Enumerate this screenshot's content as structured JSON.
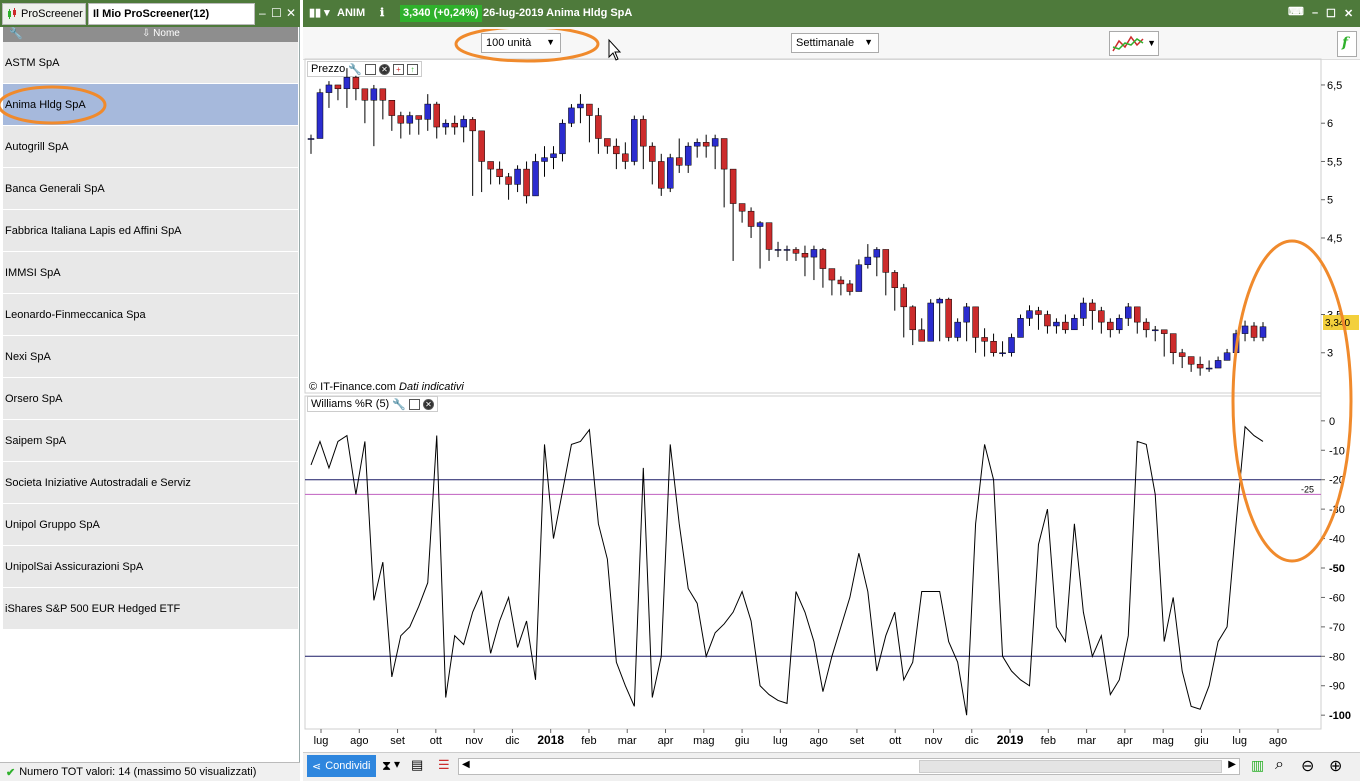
{
  "left_panel": {
    "tab1_label": "ProScreener",
    "tab2_label": "Il Mio ProScreener(12)",
    "column_header": "Nome",
    "items": [
      {
        "label": "ASTM SpA"
      },
      {
        "label": "Anima Hldg SpA"
      },
      {
        "label": "Autogrill SpA"
      },
      {
        "label": "Banca Generali SpA"
      },
      {
        "label": "Fabbrica Italiana Lapis ed Affini SpA"
      },
      {
        "label": "IMMSI SpA"
      },
      {
        "label": "Leonardo-Finmeccanica Spa"
      },
      {
        "label": "Nexi SpA"
      },
      {
        "label": "Orsero SpA"
      },
      {
        "label": "Saipem SpA"
      },
      {
        "label": "Societa Iniziative Autostradali e Serviz"
      },
      {
        "label": "Unipol Gruppo SpA"
      },
      {
        "label": "UnipolSai Assicurazioni SpA"
      },
      {
        "label": "iShares S&P 500 EUR Hedged ETF"
      }
    ],
    "selected_index": 1,
    "status_text": "Numero TOT valori: 14 (massimo 50 visualizzati)"
  },
  "right_panel": {
    "ticker": "ANIM",
    "price_badge": "3,340 (+0,24%)",
    "title": "26-lug-2019 Anima Hldg SpA",
    "units_select": "100 unità",
    "period_select": "Settimanale",
    "price_panel_title": "Prezzo",
    "indicator_panel_title": "Williams %R (5)",
    "watermark": "© IT-Finance.com",
    "watermark_note": "Dati indicativi",
    "last_price_label": "3,340",
    "share_button": "Condividi",
    "colors": {
      "header": "#4e7a3b",
      "up": "#2b2ccf",
      "down": "#cc2b2b",
      "badge": "#2fb12c",
      "annotation": "#f08a2c"
    }
  },
  "chart_data": [
    {
      "type": "candlestick",
      "title": "Prezzo",
      "ylim": [
        2.5,
        6.8
      ],
      "y_ticks": [
        "6,5",
        "6",
        "5,5",
        "5",
        "4,5",
        "3,5",
        "3"
      ],
      "x_ticks": [
        "lug",
        "ago",
        "set",
        "ott",
        "nov",
        "dic",
        "2018",
        "feb",
        "mar",
        "apr",
        "mag",
        "giu",
        "lug",
        "ago",
        "set",
        "ott",
        "nov",
        "dic",
        "2019",
        "feb",
        "mar",
        "apr",
        "mag",
        "giu",
        "lug",
        "ago"
      ],
      "close": [
        5.8,
        6.4,
        6.5,
        6.45,
        6.6,
        6.45,
        6.3,
        6.45,
        6.3,
        6.1,
        6.0,
        6.1,
        6.05,
        6.25,
        5.95,
        6.0,
        5.95,
        6.05,
        5.9,
        5.5,
        5.4,
        5.3,
        5.2,
        5.4,
        5.05,
        5.5,
        5.55,
        5.6,
        6.0,
        6.2,
        6.25,
        6.1,
        5.8,
        5.7,
        5.6,
        5.5,
        6.05,
        5.7,
        5.5,
        5.15,
        5.55,
        5.45,
        5.7,
        5.75,
        5.7,
        5.8,
        5.4,
        4.95,
        4.85,
        4.65,
        4.7,
        4.35,
        4.35,
        4.35,
        4.3,
        4.25,
        4.35,
        4.1,
        3.95,
        3.9,
        3.8,
        4.15,
        4.25,
        4.35,
        4.05,
        3.85,
        3.6,
        3.3,
        3.15,
        3.65,
        3.7,
        3.2,
        3.4,
        3.6,
        3.2,
        3.15,
        3.0,
        3.0,
        3.2,
        3.45,
        3.55,
        3.5,
        3.35,
        3.4,
        3.3,
        3.45,
        3.65,
        3.55,
        3.4,
        3.3,
        3.45,
        3.6,
        3.4,
        3.3,
        3.3,
        3.25,
        3.0,
        2.95,
        2.85,
        2.8,
        2.8,
        2.9,
        3.0,
        3.25,
        3.35,
        3.2,
        3.34
      ],
      "low": [
        5.6,
        5.8,
        6.2,
        6.3,
        6.2,
        6.3,
        6.0,
        5.7,
        6.05,
        5.9,
        5.8,
        5.85,
        5.85,
        5.9,
        5.8,
        5.85,
        5.85,
        5.75,
        5.05,
        5.1,
        5.2,
        5.2,
        5.0,
        5.1,
        4.95,
        5.05,
        5.3,
        5.4,
        5.5,
        5.95,
        6.0,
        5.75,
        5.6,
        5.6,
        5.4,
        5.4,
        5.45,
        5.4,
        5.2,
        5.05,
        5.1,
        5.35,
        5.35,
        5.55,
        5.55,
        5.4,
        4.9,
        4.2,
        4.7,
        4.5,
        4.1,
        4.2,
        4.25,
        4.2,
        4.2,
        4.0,
        3.95,
        3.85,
        3.75,
        3.75,
        3.75,
        3.9,
        4.1,
        4.0,
        3.75,
        3.55,
        3.2,
        3.1,
        3.15,
        3.2,
        3.15,
        3.15,
        3.15,
        3.15,
        3.0,
        2.95,
        2.95,
        2.95,
        2.95,
        3.2,
        3.35,
        3.3,
        3.25,
        3.25,
        3.25,
        3.3,
        3.35,
        3.3,
        3.25,
        3.2,
        3.25,
        3.35,
        3.25,
        3.2,
        3.15,
        2.95,
        2.85,
        2.8,
        2.75,
        2.7,
        2.75,
        2.8,
        2.9,
        3.1,
        3.15,
        3.15,
        3.15
      ],
      "high": [
        5.85,
        6.45,
        6.55,
        6.5,
        6.72,
        6.62,
        6.45,
        6.5,
        6.35,
        6.2,
        6.15,
        6.15,
        6.1,
        6.38,
        6.28,
        6.05,
        6.1,
        6.1,
        6.08,
        5.55,
        5.5,
        5.5,
        5.35,
        5.45,
        5.5,
        5.6,
        5.7,
        5.7,
        6.05,
        6.25,
        6.38,
        6.25,
        6.2,
        5.8,
        5.8,
        5.75,
        6.1,
        6.1,
        5.75,
        5.6,
        5.6,
        5.8,
        5.75,
        5.8,
        5.85,
        5.85,
        5.8,
        5.0,
        4.95,
        4.9,
        4.72,
        4.55,
        4.45,
        4.4,
        4.38,
        4.4,
        4.4,
        4.37,
        4.1,
        4.0,
        3.95,
        4.22,
        4.42,
        4.38,
        4.3,
        4.08,
        3.9,
        3.62,
        3.45,
        3.7,
        3.72,
        3.72,
        3.45,
        3.65,
        3.6,
        3.32,
        3.25,
        3.15,
        3.25,
        3.5,
        3.62,
        3.6,
        3.55,
        3.45,
        3.5,
        3.5,
        3.72,
        3.7,
        3.6,
        3.45,
        3.5,
        3.65,
        3.6,
        3.45,
        3.35,
        3.3,
        3.2,
        3.05,
        2.92,
        2.95,
        2.9,
        2.95,
        3.05,
        3.3,
        3.42,
        3.4,
        3.4
      ]
    },
    {
      "type": "line",
      "title": "Williams %R (5)",
      "ylim": [
        -103,
        3
      ],
      "y_ticks": [
        0,
        -10,
        -20,
        -30,
        -40,
        -50,
        -60,
        -70,
        -80,
        -90,
        -100
      ],
      "reference_lines": [
        {
          "value": -20,
          "color": "#1a1a66"
        },
        {
          "value": -25,
          "color": "#c060c0",
          "label": "-25"
        },
        {
          "value": -80,
          "color": "#1a1a66"
        }
      ],
      "values": [
        -15,
        -7,
        -16,
        -7,
        -5,
        -25,
        -7,
        -61,
        -48,
        -87,
        -73,
        -70,
        -63,
        -55,
        -5,
        -94,
        -73,
        -76,
        -65,
        -58,
        -79,
        -68,
        -60,
        -77,
        -68,
        -88,
        -8,
        -40,
        -24,
        -8,
        -7,
        -3,
        -35,
        -47,
        -82,
        -90,
        -97,
        -16,
        -94,
        -80,
        -8,
        -35,
        -57,
        -62,
        -80,
        -72,
        -69,
        -65,
        -58,
        -68,
        -90,
        -93,
        -95,
        -96,
        -58,
        -65,
        -75,
        -92,
        -80,
        -70,
        -60,
        -45,
        -58,
        -85,
        -73,
        -65,
        -88,
        -82,
        -58,
        -58,
        -58,
        -75,
        -82,
        -100,
        -35,
        -8,
        -20,
        -80,
        -85,
        -88,
        -90,
        -42,
        -30,
        -70,
        -75,
        -35,
        -65,
        -80,
        -73,
        -93,
        -88,
        -73,
        -7,
        -8,
        -25,
        -75,
        -60,
        -85,
        -97,
        -98,
        -90,
        -75,
        -70,
        -35,
        -2,
        -5,
        -7
      ]
    }
  ]
}
